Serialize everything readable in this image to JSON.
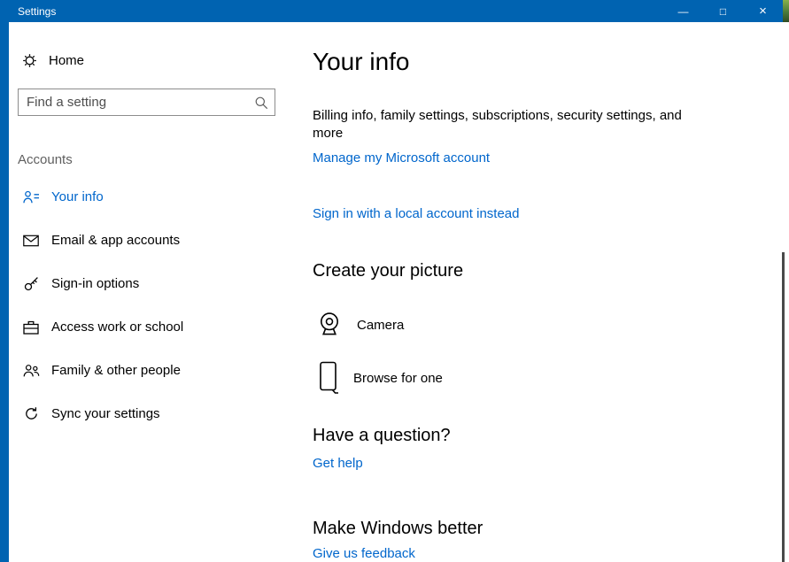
{
  "window": {
    "title": "Settings",
    "controls": {
      "minimize": "—",
      "maximize": "□",
      "close": "×"
    }
  },
  "colors": {
    "titlebar": "#0063b1",
    "link": "#0066cc"
  },
  "sidebar": {
    "home": {
      "label": "Home",
      "icon": "gear-icon"
    },
    "search": {
      "placeholder": "Find a setting",
      "icon": "search-icon"
    },
    "section_label": "Accounts",
    "items": [
      {
        "label": "Your info",
        "icon": "your-info-icon",
        "selected": true
      },
      {
        "label": "Email & app accounts",
        "icon": "email-icon",
        "selected": false
      },
      {
        "label": "Sign-in options",
        "icon": "key-icon",
        "selected": false
      },
      {
        "label": "Access work or school",
        "icon": "briefcase-icon",
        "selected": false
      },
      {
        "label": "Family & other people",
        "icon": "people-icon",
        "selected": false
      },
      {
        "label": "Sync your settings",
        "icon": "sync-icon",
        "selected": false
      }
    ]
  },
  "main": {
    "page_title": "Your info",
    "account_summary": "Billing info, family settings, subscriptions, security settings, and more",
    "manage_account_link": "Manage my Microsoft account",
    "local_account_link": "Sign in with a local account instead",
    "create_picture": {
      "heading": "Create your picture",
      "camera_label": "Camera",
      "browse_label": "Browse for one"
    },
    "question": {
      "heading": "Have a question?",
      "link_label": "Get help"
    },
    "feedback": {
      "heading": "Make Windows better",
      "link_label": "Give us feedback"
    }
  }
}
